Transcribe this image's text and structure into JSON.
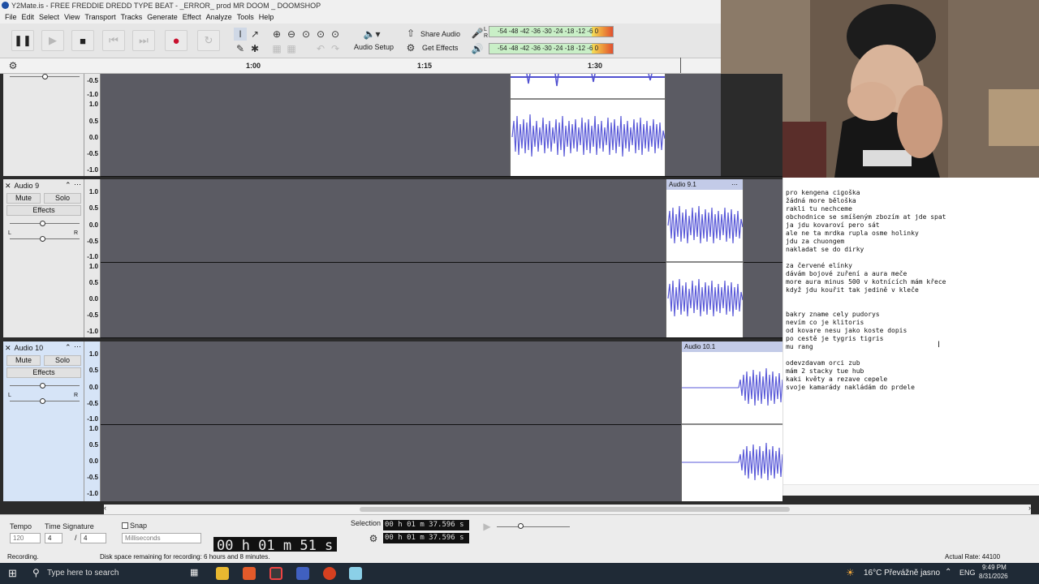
{
  "window": {
    "title": "Y2Mate.is - FREE FREDDIE DREDD TYPE BEAT - _ERROR_ prod MR DOOM _ DOOMSHOP"
  },
  "menu": [
    "File",
    "Edit",
    "Select",
    "View",
    "Transport",
    "Tracks",
    "Generate",
    "Effect",
    "Analyze",
    "Tools",
    "Help"
  ],
  "toolbar": {
    "audio_setup": "Audio Setup",
    "share_audio": "Share Audio",
    "get_effects": "Get Effects",
    "meter_record_ticks": "-54 -48 -42 -36 -30 -24 -18 -12 -6 0",
    "meter_play_ticks": "-54 -48 -42 -36 -30 -24 -18 -12 -6 0",
    "meter_l": "L",
    "meter_r": "R"
  },
  "ruler": {
    "ticks": [
      "1:00",
      "1:15",
      "1:30"
    ]
  },
  "tracks": [
    {
      "name": "",
      "scale": [
        "-0.5",
        "-1.0",
        "1.0",
        "0.5",
        "0.0",
        "-0.5",
        "-1.0"
      ]
    },
    {
      "name": "Audio 9",
      "mute": "Mute",
      "solo": "Solo",
      "effects": "Effects",
      "clip": "Audio 9.1",
      "pan_l": "L",
      "pan_r": "R",
      "scale": [
        "1.0",
        "0.5",
        "0.0",
        "-0.5",
        "-1.0",
        "1.0",
        "0.5",
        "0.0",
        "-0.5",
        "-1.0"
      ]
    },
    {
      "name": "Audio 10",
      "mute": "Mute",
      "solo": "Solo",
      "effects": "Effects",
      "clip": "Audio 10.1",
      "pan_l": "L",
      "pan_r": "R",
      "scale": [
        "1.0",
        "0.5",
        "0.0",
        "-0.5",
        "-1.0",
        "1.0",
        "0.5",
        "0.0",
        "-0.5",
        "-1.0"
      ]
    }
  ],
  "lyrics": "pro kengena cigoška\nžádná more běloška\nrakli tu nechceme\nobchodnice se smíšeným zbozím at jde spat\nja jdu kovaroví pero sát\nale ne ta mrdka rupla osme holinky\njdu za chuongem\nnakladat se do dirky\n\nza červené elínky\ndávám bojové zuření a aura meče\nmore aura minus 500 v kotnících mám křece\nkdyž jdu kouřit tak jedině v kleče\n\n\nbakry zname cely pudorys\nnevím co je klitoris\nod kovare nesu jako koste dopis\npo cestě je tygris tigris\nmu rang\n\nodevzdavam orci zub\nmám 2 stacky tue hub\nkaki květy a rezave cepele\nsvoje kamarády nakládám do prdele",
  "bottom": {
    "tempo_label": "Tempo",
    "tempo_value": "120",
    "time_sig_label": "Time Signature",
    "time_sig_num": "4",
    "time_sig_den": "4",
    "snap_label": "Snap",
    "snap_unit": "Milliseconds",
    "big_time": "00 h 01 m 51 s",
    "selection_label": "Selection",
    "sel_start": "00 h 01 m 37.596 s",
    "sel_end": "00 h 01 m 37.596 s"
  },
  "status": {
    "left": "Recording.",
    "middle": "Disk space remaining for recording: 6 hours and 8 minutes.",
    "right": "Actual Rate: 44100"
  },
  "taskbar": {
    "search_placeholder": "Type here to search",
    "weather": "16°C  Převážně jasno",
    "lang": "ENG",
    "time": "9:49 PM",
    "date": "8/31/2026"
  }
}
